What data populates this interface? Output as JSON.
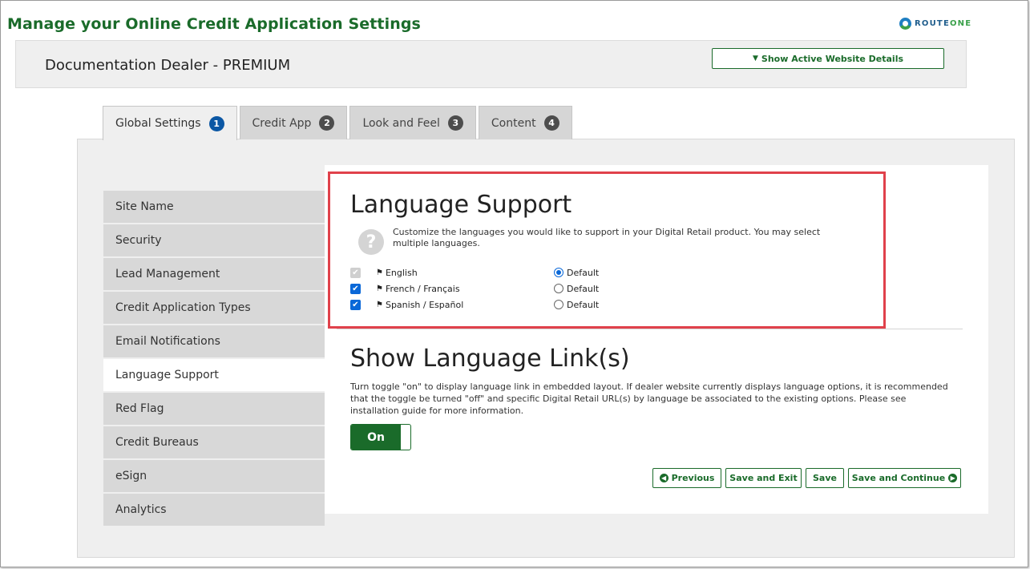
{
  "page_title": "Manage your Online Credit Application Settings",
  "logo": {
    "text_route": "ROUTE",
    "text_one": "ONE"
  },
  "dealer": {
    "name": "Documentation Dealer - PREMIUM",
    "show_details_label": "Show Active Website Details"
  },
  "tabs": [
    {
      "label": "Global Settings",
      "num": "1"
    },
    {
      "label": "Credit App",
      "num": "2"
    },
    {
      "label": "Look and Feel",
      "num": "3"
    },
    {
      "label": "Content",
      "num": "4"
    }
  ],
  "sidebar": {
    "items": [
      {
        "label": "Site Name"
      },
      {
        "label": "Security"
      },
      {
        "label": "Lead Management"
      },
      {
        "label": "Credit Application Types"
      },
      {
        "label": "Email Notifications"
      },
      {
        "label": "Language Support"
      },
      {
        "label": "Red Flag"
      },
      {
        "label": "Credit Bureaus"
      },
      {
        "label": "eSign"
      },
      {
        "label": "Analytics"
      }
    ],
    "active": "Language Support"
  },
  "language_support": {
    "heading": "Language Support",
    "help_icon_glyph": "?",
    "description": "Customize the languages you would like to support in your Digital Retail product. You may select multiple languages.",
    "languages": [
      {
        "label": "English",
        "checked": true,
        "disabled": true,
        "default_label": "Default",
        "is_default": true
      },
      {
        "label": "French / Français",
        "checked": true,
        "disabled": false,
        "default_label": "Default",
        "is_default": false
      },
      {
        "label": "Spanish / Español",
        "checked": true,
        "disabled": false,
        "default_label": "Default",
        "is_default": false
      }
    ]
  },
  "language_link": {
    "heading": "Show Language Link(s)",
    "description": "Turn toggle \"on\" to display language link in embedded layout. If dealer website currently displays language options, it is recommended that the toggle be turned \"off\" and specific Digital Retail URL(s) by language be associated to the existing options. Please see installation guide for more information.",
    "toggle_label": "On",
    "toggle_state": true
  },
  "buttons": {
    "previous": "Previous",
    "save_exit": "Save and Exit",
    "save": "Save",
    "save_continue": "Save and Continue"
  },
  "colors": {
    "brand_green": "#1a6b2a",
    "highlight_red": "#e0414b",
    "active_tab_badge": "#0b57a4",
    "checkbox_blue": "#0a68d8"
  },
  "icons": {
    "chevron": "chevron-down-icon",
    "help": "question-circle-icon",
    "flag": "flag-icon",
    "previous": "arrow-left-circle-icon",
    "continue": "arrow-right-circle-icon"
  }
}
